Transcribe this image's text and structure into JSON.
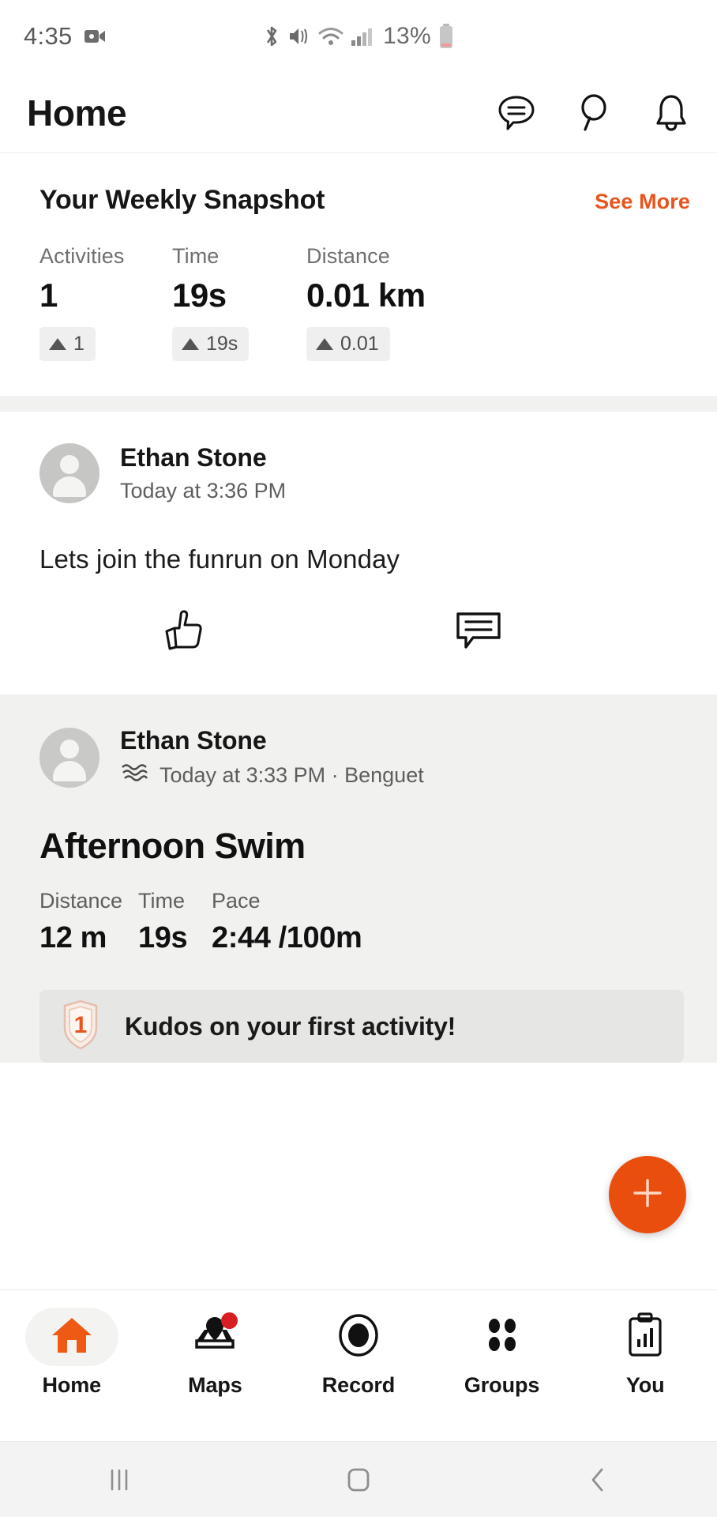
{
  "status_bar": {
    "time": "4:35",
    "battery_percent": "13%",
    "icons": [
      "camera-icon",
      "bluetooth-icon",
      "mute-icon",
      "wifi-icon",
      "cellular-signal-icon",
      "battery-icon"
    ]
  },
  "header": {
    "title": "Home",
    "actions": [
      "chat-icon",
      "search-icon",
      "notifications-bell-icon"
    ]
  },
  "snapshot": {
    "title": "Your Weekly Snapshot",
    "see_more_label": "See More",
    "accent_color": "#E8541C",
    "stats": [
      {
        "label": "Activities",
        "value": "1",
        "change": "1",
        "trend": "up"
      },
      {
        "label": "Time",
        "value": "19s",
        "change": "19s",
        "trend": "up"
      },
      {
        "label": "Distance",
        "value": "0.01 km",
        "change": "0.01",
        "trend": "up"
      }
    ]
  },
  "feed": {
    "text_post": {
      "author": "Ethan Stone",
      "timestamp": "Today at 3:36 PM",
      "body": "Lets join the funrun on Monday",
      "kudos_icon": "thumbs-up-icon",
      "comment_icon": "comment-icon"
    },
    "activity_post": {
      "author": "Ethan Stone",
      "sport_icon": "swim-waves-icon",
      "meta": "Today at 3:33 PM · Benguet",
      "title": "Afternoon Swim",
      "stats": [
        {
          "label": "Distance",
          "value": "12 m"
        },
        {
          "label": "Time",
          "value": "19s"
        },
        {
          "label": "Pace",
          "value": "2:44 /100m"
        }
      ],
      "banner": {
        "text": "Kudos on your first activity!",
        "badge_icon": "first-activity-badge-icon",
        "badge_number": "1"
      }
    }
  },
  "fab": {
    "icon": "plus-icon",
    "color": "#E94E0F"
  },
  "bottom_nav": {
    "items": [
      {
        "label": "Home",
        "icon": "home-icon",
        "active": true,
        "badge": false
      },
      {
        "label": "Maps",
        "icon": "map-pin-icon",
        "active": false,
        "badge": true
      },
      {
        "label": "Record",
        "icon": "record-icon",
        "active": false,
        "badge": false
      },
      {
        "label": "Groups",
        "icon": "groups-icon",
        "active": false,
        "badge": false
      },
      {
        "label": "You",
        "icon": "clipboard-chart-icon",
        "active": false,
        "badge": false
      }
    ]
  },
  "system_nav": {
    "buttons": [
      "recents-icon",
      "home-square-icon",
      "back-icon"
    ]
  }
}
